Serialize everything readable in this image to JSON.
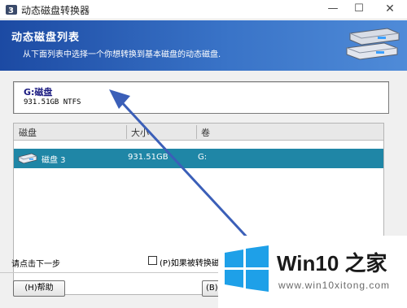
{
  "window": {
    "title": "动态磁盘转换器",
    "min_label": "—",
    "max_label": "☐",
    "close_label": "✕"
  },
  "banner": {
    "title": "动态磁盘列表",
    "subtitle": "从下面列表中选择一个你想转换到基本磁盘的动态磁盘."
  },
  "selected_disk": {
    "name": "G:磁盘",
    "info": "931.51GB NTFS"
  },
  "table": {
    "headers": [
      "磁盘",
      "大小",
      "卷"
    ],
    "rows": [
      {
        "disk": "磁盘 3",
        "size": "931.51GB",
        "volume": "G:"
      }
    ]
  },
  "footer": {
    "hint": "请点击下一步",
    "checkbox_label": "(P)如果被转换磁盘",
    "help_button": "(H)帮助",
    "next_button": "(B)"
  },
  "watermark": {
    "brand": "Win10 之家",
    "url": "www.win10xitong.com"
  },
  "colors": {
    "banner": "#1c4aa3",
    "row_selected": "#1f86a6",
    "arrow": "#3b5fb8"
  }
}
